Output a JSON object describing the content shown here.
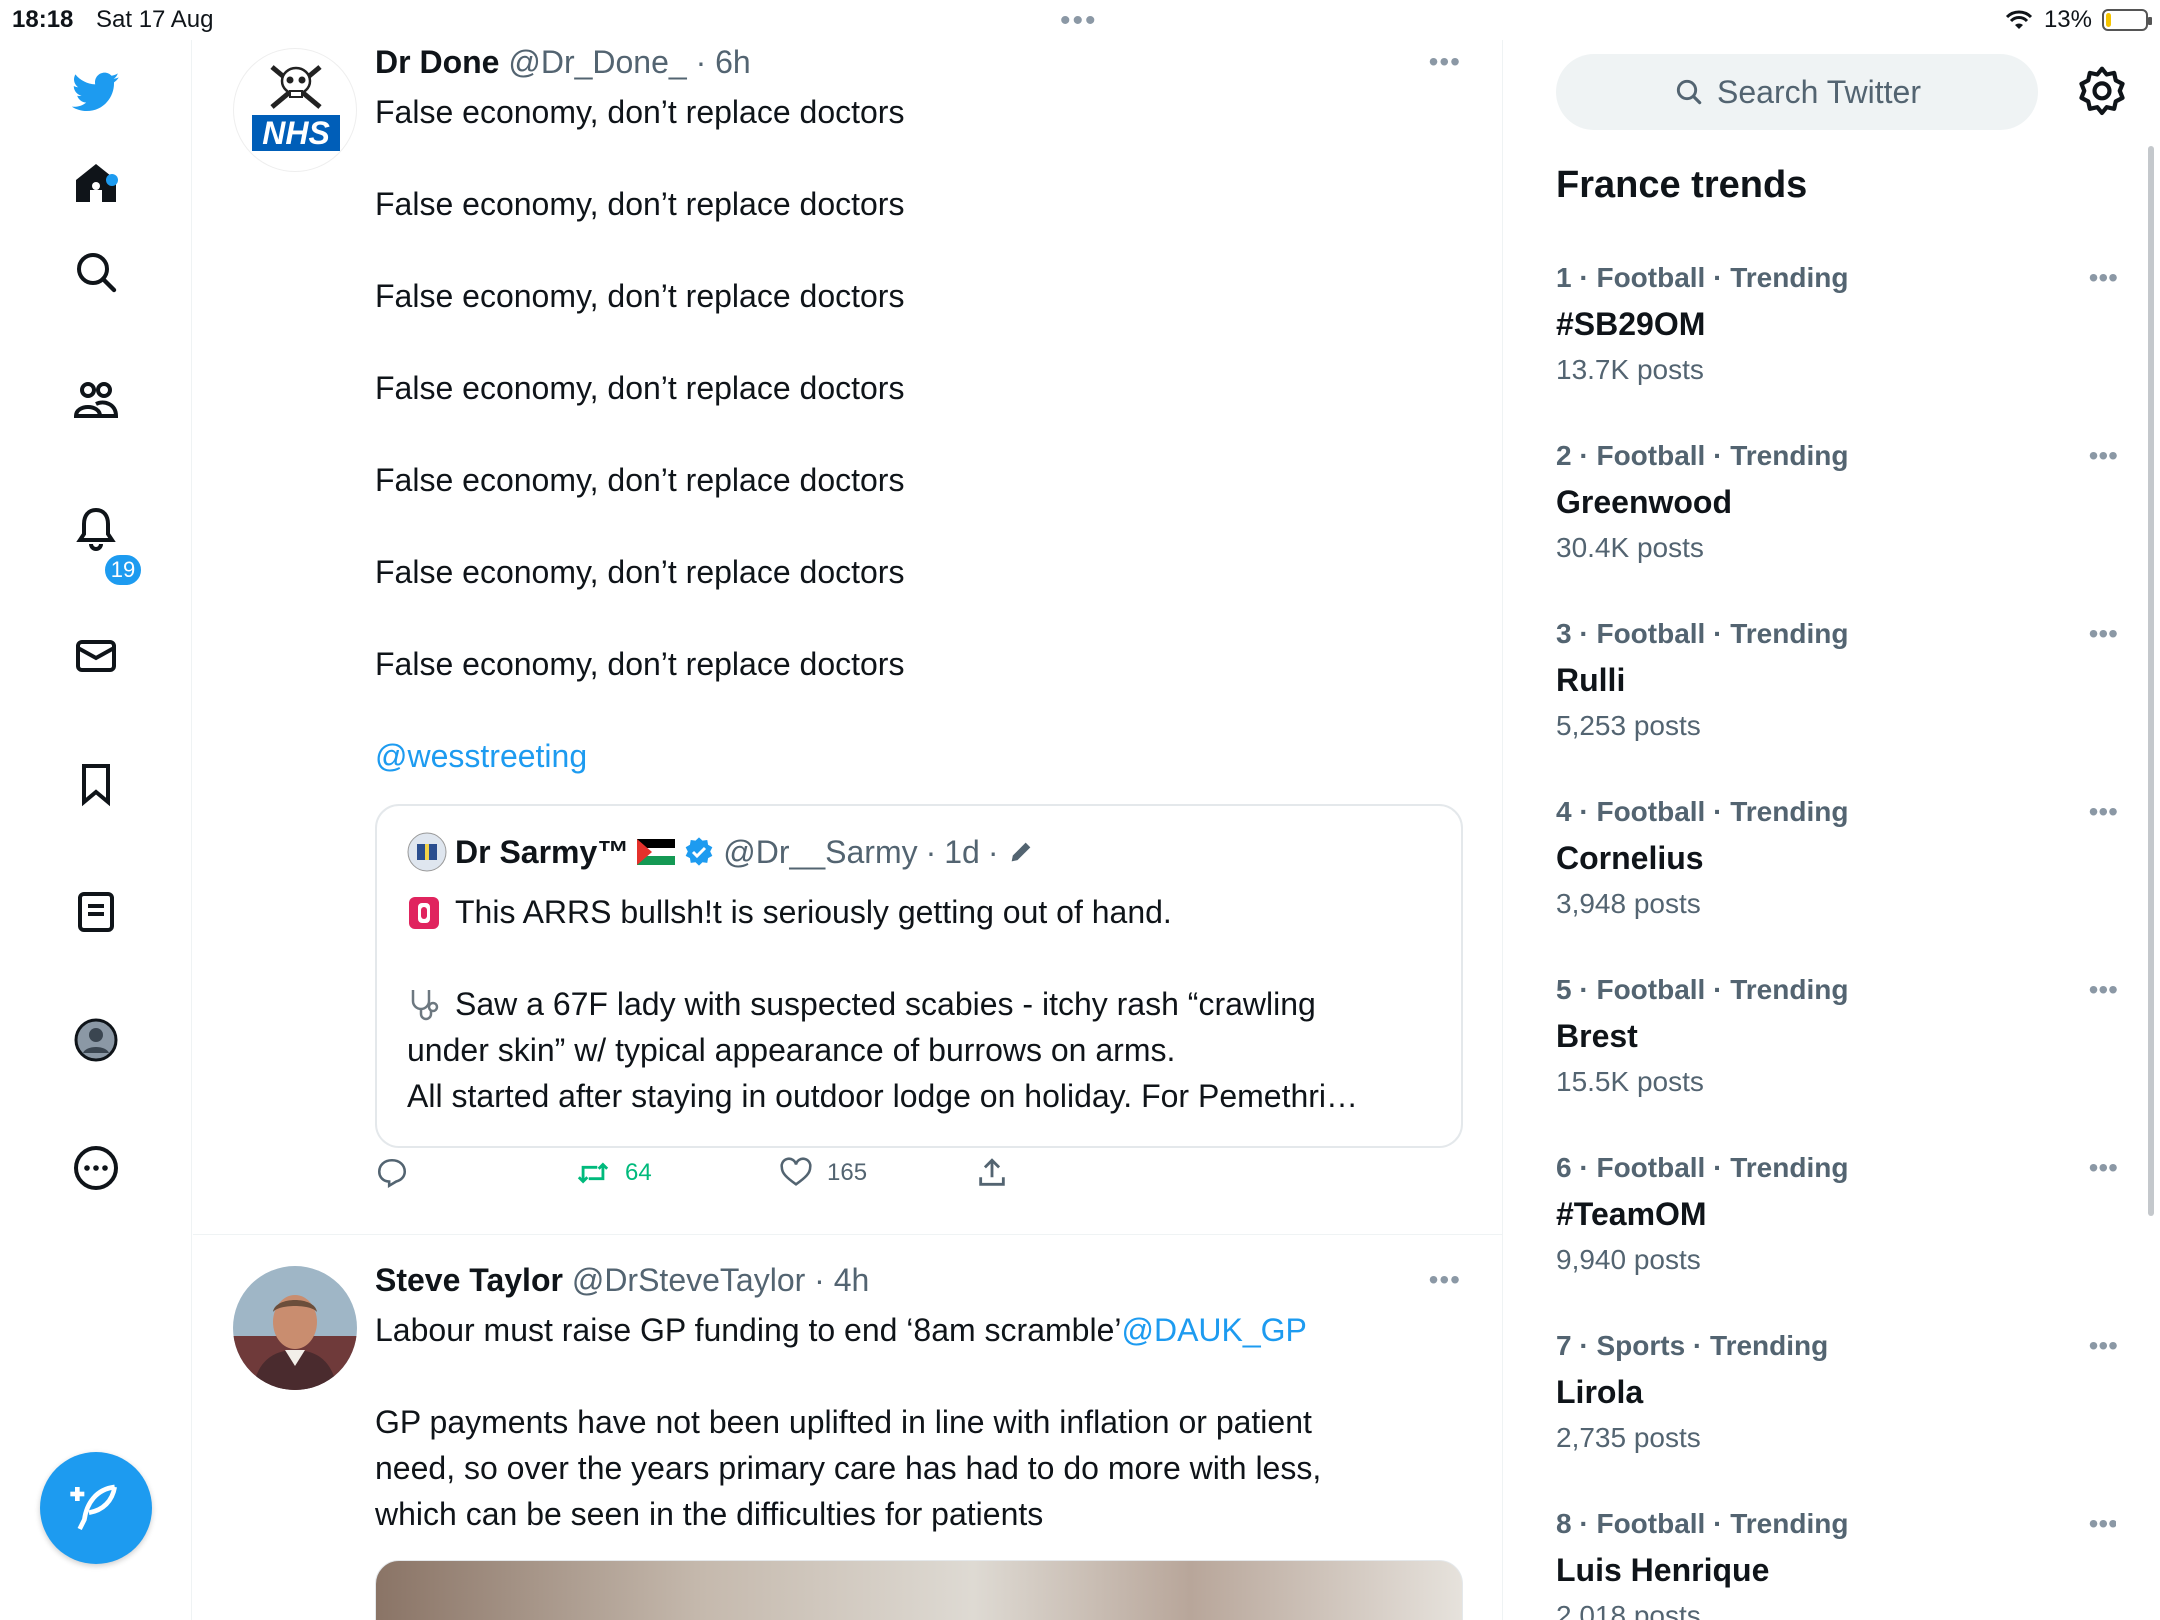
{
  "status_bar": {
    "time": "18:18",
    "date": "Sat 17 Aug",
    "battery": "13%",
    "battery_level": 0.13
  },
  "nav": {
    "notifications_count": "19"
  },
  "tweets": [
    {
      "name": "Dr Done",
      "handle": "@Dr_Done_",
      "time": "6h",
      "lines": [
        "False economy, don’t replace doctors",
        "False economy, don’t replace doctors",
        "False economy, don’t replace doctors",
        "False economy, don’t replace doctors",
        "False economy, don’t replace doctors",
        "False economy, don’t replace doctors",
        "False economy, don’t replace doctors"
      ],
      "mention": "@wesstreeting",
      "avatar_text": "NHS",
      "quote": {
        "name": "Dr Sarmy™",
        "handle": "@Dr__Sarmy",
        "time": "1d",
        "lines": [
          "This ARRS bullsh!t is seriously getting out of hand.",
          "Saw a 67F lady with suspected scabies - itchy rash “crawling",
          "under skin” w/ typical appearance of burrows on arms.",
          "All started after staying in outdoor lodge on holiday. For Pemethri…"
        ]
      },
      "actions": {
        "retweets": "64",
        "likes": "165"
      }
    },
    {
      "name": "Steve Taylor",
      "handle": "@DrSteveTaylor",
      "time": "4h",
      "line1": "Labour must raise GP funding to end ‘8am scramble’",
      "mention": "@DAUK_GP",
      "lines": [
        "GP payments have not been uplifted in line with inflation or patient",
        "need, so over the years primary care has had to do more with less,",
        "which can be seen in the difficulties for patients"
      ]
    }
  ],
  "sidebar": {
    "search_placeholder": "Search Twitter",
    "trends_title": "France trends",
    "trends": [
      {
        "rank": "1",
        "category": "Football · Trending",
        "topic": "#SB29OM",
        "count": "13.7K posts"
      },
      {
        "rank": "2",
        "category": "Football · Trending",
        "topic": "Greenwood",
        "count": "30.4K posts"
      },
      {
        "rank": "3",
        "category": "Football · Trending",
        "topic": "Rulli",
        "count": "5,253 posts"
      },
      {
        "rank": "4",
        "category": "Football · Trending",
        "topic": "Cornelius",
        "count": "3,948 posts"
      },
      {
        "rank": "5",
        "category": "Football · Trending",
        "topic": "Brest",
        "count": "15.5K posts"
      },
      {
        "rank": "6",
        "category": "Football · Trending",
        "topic": "#TeamOM",
        "count": "9,940 posts"
      },
      {
        "rank": "7",
        "category": "Sports · Trending",
        "topic": "Lirola",
        "count": "2,735 posts"
      },
      {
        "rank": "8",
        "category": "Football · Trending",
        "topic": "Luis Henrique",
        "count": "2,018 posts"
      }
    ]
  },
  "colors": {
    "accent": "#1d9bf0",
    "retweet": "#00ba7c",
    "secondary_text": "#536471"
  }
}
